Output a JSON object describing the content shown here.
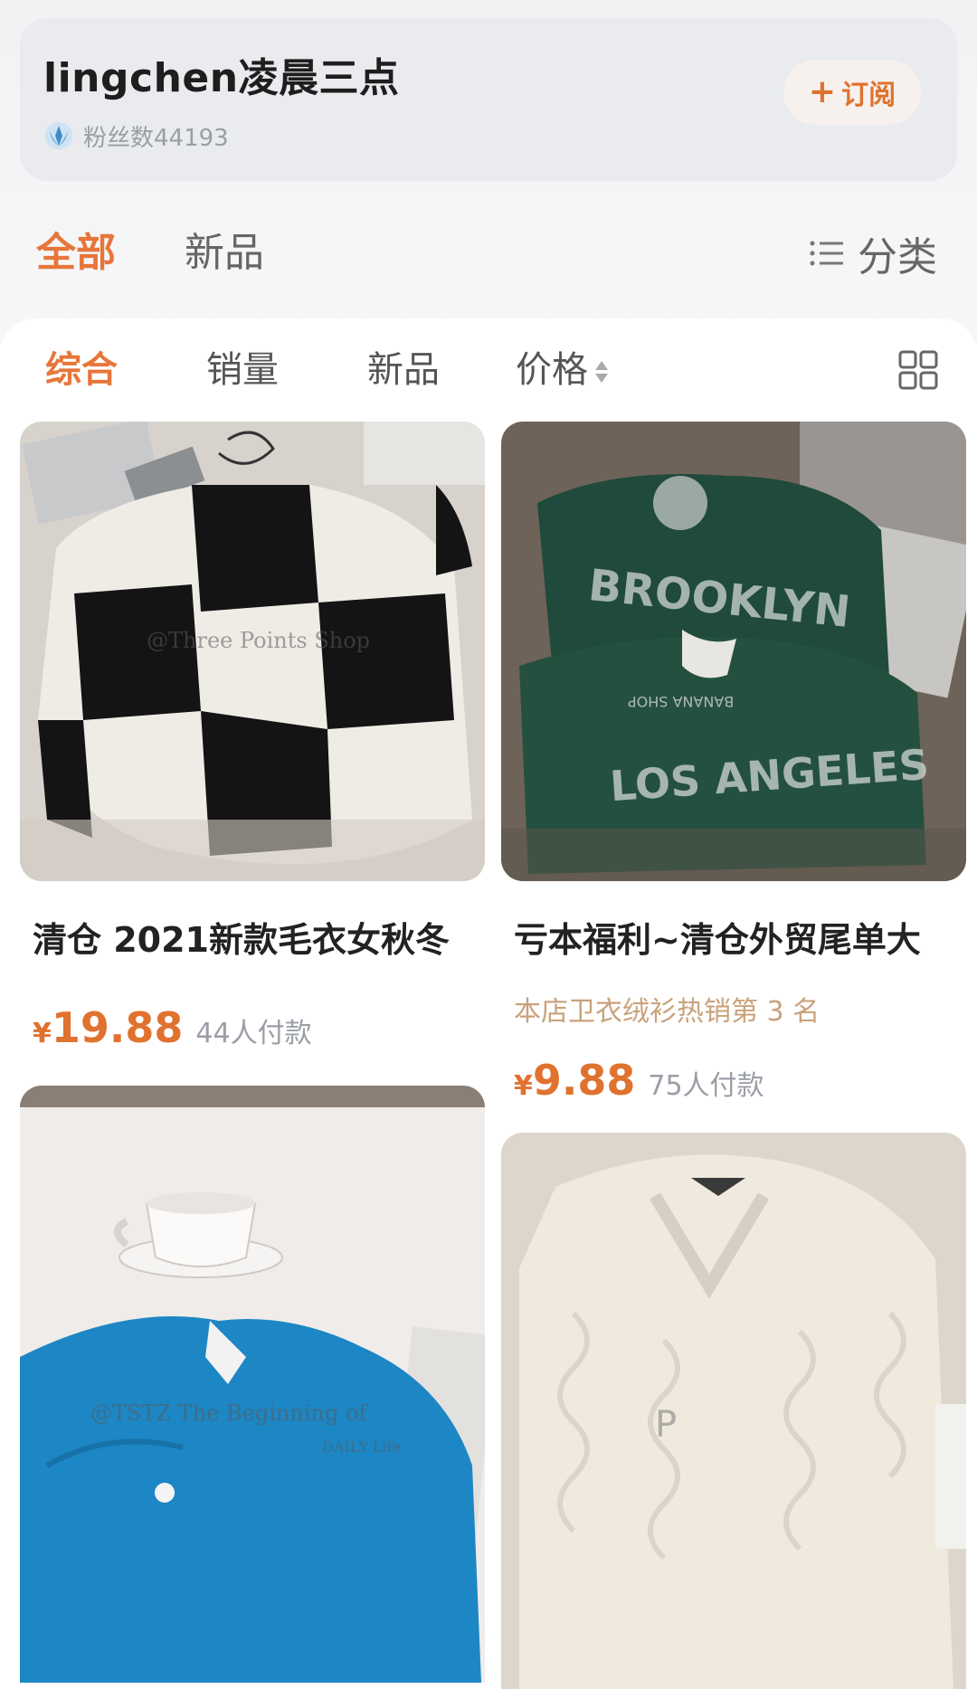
{
  "shop": {
    "name": "lingchen凌晨三点",
    "fans_label": "粉丝数44193",
    "subscribe_label": "订阅"
  },
  "tabs": {
    "all": "全部",
    "new": "新品",
    "category": "分类"
  },
  "sort": {
    "comprehensive": "综合",
    "sales": "销量",
    "new": "新品",
    "price": "价格"
  },
  "products": [
    {
      "title": "清仓 2021新款毛衣女秋冬",
      "subtitle": "",
      "currency": "¥",
      "price": "19.88",
      "paid": "44人付款",
      "watermark": "@Three Points Shop"
    },
    {
      "title": "亏本福利~清仓外贸尾单大",
      "subtitle": "本店卫衣绒衫热销第 3 名",
      "currency": "¥",
      "price": "9.88",
      "paid": "75人付款",
      "text_top": "BROOKLYN",
      "text_mid": "BANANA SHOP",
      "text_bottom": "LOS ANGELES"
    },
    {
      "watermark": "@TSTZ  The  Beginning of",
      "watermark2": "DAILY Life"
    },
    {
      "watermark": "P"
    }
  ],
  "colors": {
    "accent": "#e7763a",
    "price": "#e0722f",
    "subtitle": "#c9a27b"
  }
}
